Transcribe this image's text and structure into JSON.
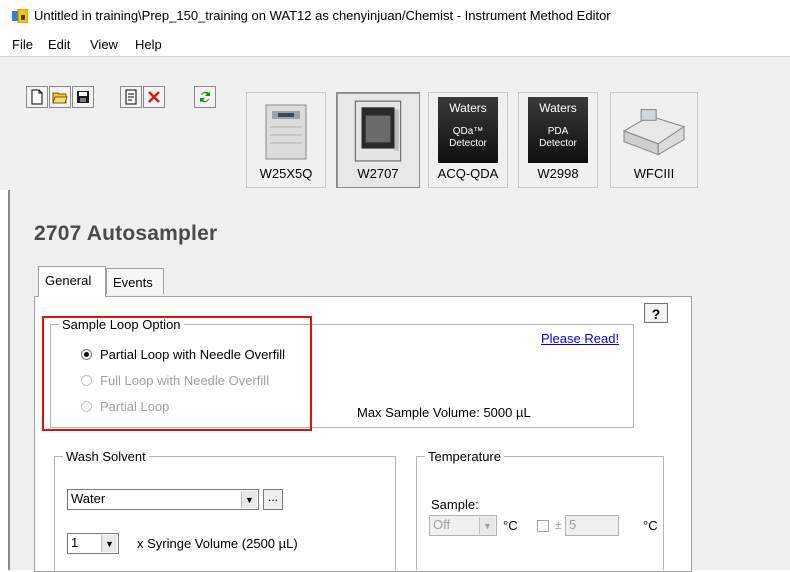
{
  "window": {
    "title": "Untitled in training\\Prep_150_training on WAT12 as chenyinjuan/Chemist - Instrument Method Editor"
  },
  "menu": [
    "File",
    "Edit",
    "View",
    "Help"
  ],
  "toolbar": {
    "icons": [
      "new-document-icon",
      "open-folder-icon",
      "save-icon",
      "report-icon",
      "delete-icon",
      "refresh-icon"
    ]
  },
  "instruments": [
    {
      "label": "W25X5Q",
      "image_text": ""
    },
    {
      "label": "W2707",
      "image_text": ""
    },
    {
      "label": "ACQ-QDA",
      "image_text": "Waters",
      "image_sub": "QDa™\nDetector"
    },
    {
      "label": "W2998",
      "image_text": "Waters",
      "image_sub": "PDA\nDetector"
    },
    {
      "label": "WFCIII",
      "image_text": ""
    }
  ],
  "active_instrument": "W2707",
  "panel": {
    "heading": "2707 Autosampler",
    "tabs": [
      "General",
      "Events"
    ],
    "help_label": "?",
    "sample_loop": {
      "title": "Sample Loop Option",
      "options": [
        {
          "label": "Partial Loop with Needle Overfill",
          "checked": true,
          "enabled": true
        },
        {
          "label": "Full Loop with Needle Overfill",
          "checked": false,
          "enabled": false
        },
        {
          "label": "Partial Loop",
          "checked": false,
          "enabled": false
        }
      ],
      "please_read": "Please Read!",
      "max_volume": "Max Sample Volume: 5000 µL"
    },
    "wash_solvent": {
      "title": "Wash Solvent",
      "solvent_value": "Water",
      "browse_label": "...",
      "syringe_count": "1",
      "syringe_text": "x Syringe Volume (2500 µL)"
    },
    "temperature": {
      "title": "Temperature",
      "sample_label": "Sample:",
      "sample_value": "Off",
      "unit1": "°C",
      "tolerance_prefix": "±",
      "tolerance_value": "5",
      "unit2": "°C"
    }
  }
}
